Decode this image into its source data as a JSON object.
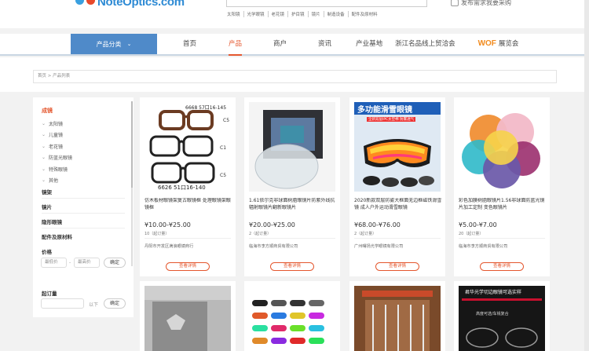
{
  "header": {
    "logo_text": "NoteOptics.com",
    "hot_words": [
      "太阳镜",
      "光学眼镜",
      "老花镜",
      "护目镜",
      "镜片",
      "制造设备",
      "配件及原材料"
    ],
    "cart_label": "发布需求我要采购"
  },
  "nav": {
    "category_button": "产品分类",
    "items": [
      "首页",
      "产品",
      "商户",
      "资讯",
      "产业基地",
      "浙江名品线上贸洽会"
    ],
    "wof_mark": "WOF",
    "wof_label": "展览会",
    "active": "产品"
  },
  "breadcrumb": "首页 > 产品列表",
  "sidebar": {
    "heading": "成镜",
    "sub_items": [
      "太阳镜",
      "儿童镜",
      "老花镜",
      "防蓝光眼镜",
      "特殊眼镜",
      "其他"
    ],
    "categories": [
      "镜架",
      "镜片",
      "隐形眼镜",
      "配件及原材料"
    ],
    "price_label": "价格",
    "min_price_placeholder": "最低价",
    "max_price_placeholder": "最高价",
    "separator": "-",
    "confirm": "确定",
    "moq_label": "起订量",
    "moq_suffix": "以下",
    "moq_confirm": "确定"
  },
  "products": [
    {
      "image_caption_top": "6668 57口16-145",
      "image_caption_bottom": "6626 51口16-140",
      "image_marks": [
        "C5",
        "C1",
        "C5"
      ],
      "title": "仿木板材眼镜架复古眼镜框 处理眼镜架眼镜框",
      "price": "¥10.00-¥25.00",
      "moq": "10（起订量）",
      "shop": "丹阳市开发区满浪眼镜商行",
      "button": "查看详情"
    },
    {
      "title": "1.61依尔克非球面树脂眼镜片防紫外线抗辐射眼镜片翻新眼镜片",
      "price": "¥20.00-¥25.00",
      "moq": "2（起订量）",
      "shop": "临海市李方顺商贸有限公司",
      "button": "查看详情"
    },
    {
      "image_title": "多功能滑雪眼镜",
      "image_subtitle": "全新双层IPC太空棉 防雾透气",
      "title": "2020新款双层防雾大框面无边框磁铁滑雪镜 成人户外运动滑雪眼镜",
      "price": "¥68.00-¥76.00",
      "moq": "2（起订量）",
      "shop": "广州曙扬光学眼镜有限公司",
      "button": "查看详情"
    },
    {
      "title": "彩色加膜树脂眼镜片1.56非球面防蓝光镜片加工定制 变色眼镜片",
      "price": "¥5.00-¥7.00",
      "moq": "20（起订量）",
      "shop": "临海市李方顺商贸有限公司",
      "button": "查看详情"
    }
  ],
  "second_row": {
    "card4_top_text": "君华光学切边眼镜可选实样",
    "card4_mid_text": "高度可选/车铣复合"
  },
  "colors": {
    "accent": "#e4572e",
    "nav_blue": "#4f8ac9",
    "wof_orange": "#f18a1c"
  }
}
